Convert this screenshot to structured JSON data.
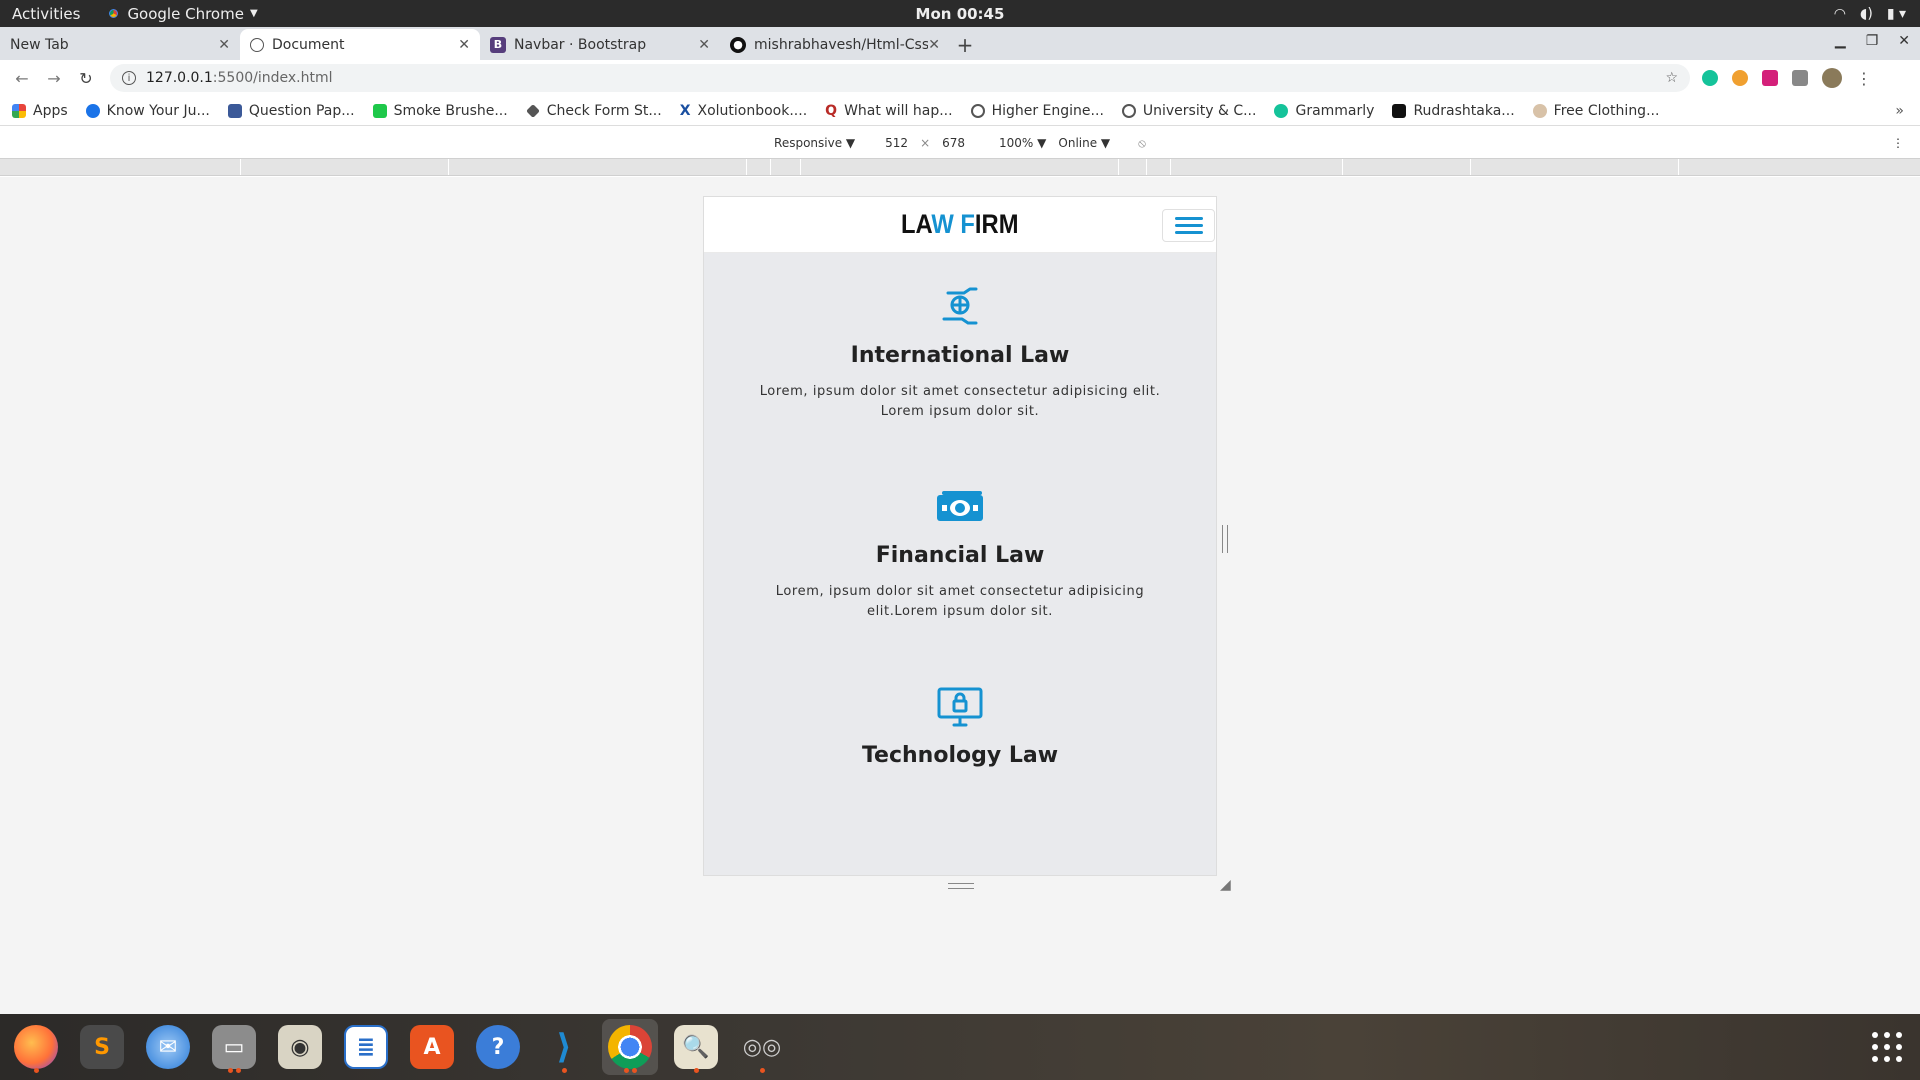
{
  "system": {
    "activities": "Activities",
    "app_name": "Google Chrome",
    "clock": "Mon 00:45"
  },
  "tabs": [
    {
      "title": "New Tab",
      "active": false
    },
    {
      "title": "Document",
      "active": true
    },
    {
      "title": "Navbar · Bootstrap",
      "active": false
    },
    {
      "title": "mishrabhavesh/Html-Css",
      "active": false
    }
  ],
  "address": {
    "host": "127.0.0.1",
    "path": ":5500/index.html"
  },
  "bookmarks": [
    {
      "label": "Apps",
      "color": "#e8453c"
    },
    {
      "label": "Know Your Ju...",
      "color": "#1a73e8"
    },
    {
      "label": "Question Pap...",
      "color": "#3b5998"
    },
    {
      "label": "Smoke Brushe...",
      "color": "#1ec84a"
    },
    {
      "label": "Check Form St...",
      "color": "#555555"
    },
    {
      "label": "Xolutionbook....",
      "color": "#1a4fa0"
    },
    {
      "label": "What will hap...",
      "color": "#b92b27"
    },
    {
      "label": "Higher Engine...",
      "color": "#555555"
    },
    {
      "label": "University & C...",
      "color": "#555555"
    },
    {
      "label": "Grammarly",
      "color": "#15c39a"
    },
    {
      "label": "Rudrashtaka...",
      "color": "#111111"
    },
    {
      "label": "Free Clothing...",
      "color": "#8a6a4a"
    }
  ],
  "devtools": {
    "mode": "Responsive ▼",
    "width": "512",
    "times": "×",
    "height": "678",
    "zoom": "100% ▼",
    "network": "Online ▼"
  },
  "site": {
    "brand_part1": "LA",
    "brand_part2": "W",
    "brand_part3": " F",
    "brand_part4": "IRM",
    "accent": "#1592d1",
    "cards": [
      {
        "icon": "globe-hands-icon",
        "title": "International Law",
        "text": "Lorem, ipsum dolor sit amet consectetur adipisicing elit. Lorem ipsum dolor sit."
      },
      {
        "icon": "money-icon",
        "title": "Financial Law",
        "text": "Lorem, ipsum dolor sit amet consectetur adipisicing elit.Lorem ipsum dolor sit."
      },
      {
        "icon": "monitor-lock-icon",
        "title": "Technology Law",
        "text": ""
      }
    ]
  },
  "dock": [
    {
      "icon": "firefox-icon",
      "color": "#ff7139"
    },
    {
      "icon": "sublime-text-icon",
      "color": "#4a4a4a"
    },
    {
      "icon": "thunderbird-icon",
      "color": "#2a7bd8"
    },
    {
      "icon": "files-icon",
      "color": "#8c8c8c"
    },
    {
      "icon": "rhythmbox-icon",
      "color": "#d9d4c4"
    },
    {
      "icon": "writer-icon",
      "color": "#2a6fc9"
    },
    {
      "icon": "software-center-icon",
      "color": "#e95420"
    },
    {
      "icon": "help-icon",
      "color": "#3b7dd8"
    },
    {
      "icon": "vscode-icon",
      "color": "#1f8ad2"
    },
    {
      "icon": "chrome-icon",
      "color": "#4285f4"
    },
    {
      "icon": "image-viewer-icon",
      "color": "#7aa74a"
    },
    {
      "icon": "dock-app-icon",
      "color": "#9aa0a6"
    }
  ]
}
